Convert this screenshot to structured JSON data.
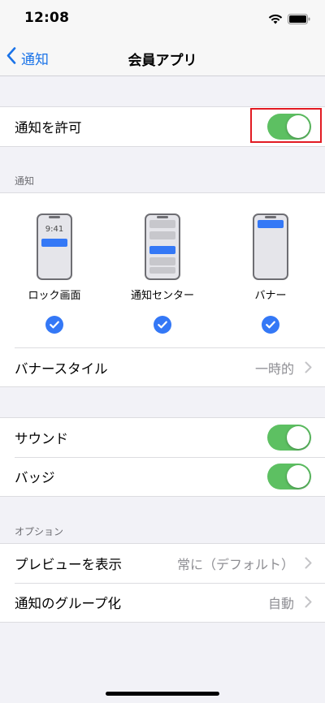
{
  "status_bar": {
    "time": "12:08"
  },
  "nav": {
    "back_label": "通知",
    "title": "会員アプリ"
  },
  "allow": {
    "label": "通知を許可",
    "enabled": true
  },
  "notifications_section": {
    "header": "通知",
    "styles": [
      {
        "label": "ロック画面",
        "preview_time": "9:41",
        "checked": true
      },
      {
        "label": "通知センター",
        "checked": true
      },
      {
        "label": "バナー",
        "checked": true
      }
    ],
    "banner_style": {
      "label": "バナースタイル",
      "value": "一時的"
    }
  },
  "sound": {
    "label": "サウンド",
    "enabled": true
  },
  "badge": {
    "label": "バッジ",
    "enabled": true
  },
  "options_section": {
    "header": "オプション",
    "preview": {
      "label": "プレビューを表示",
      "value": "常に（デフォルト）"
    },
    "grouping": {
      "label": "通知のグループ化",
      "value": "自動"
    }
  },
  "colors": {
    "accent": "#3478f6",
    "toggle_on": "#5dc062",
    "highlight": "#e21b23"
  }
}
